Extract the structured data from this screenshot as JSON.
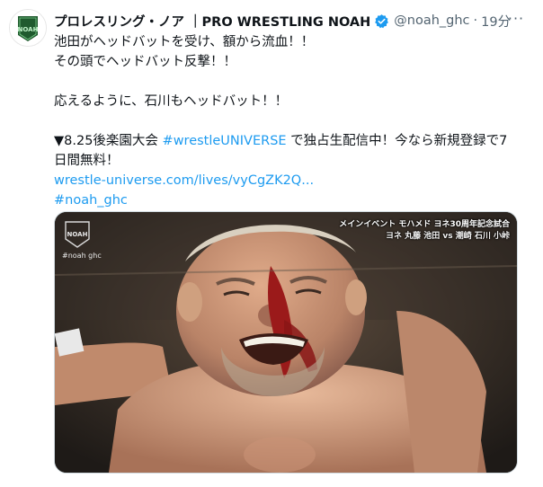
{
  "tweet": {
    "display_name": "プロレスリング・ノア ｜PRO WRESTLING NOAH",
    "handle": "@noah_ghc",
    "separator": "·",
    "time": "19分",
    "more_icon": "more-dots-icon",
    "verified_icon": "verified-badge-icon",
    "lines": [
      "池田がヘッドバットを受け、額から流血！！",
      "その頭でヘッドバット反撃！！",
      "",
      "応えるように、石川もヘッドバット！！",
      ""
    ],
    "line_event_prefix": "▼8.25後楽園大会 ",
    "line_event_hashtag": "#wrestleUNIVERSE",
    "line_event_suffix": " で独占生配信中！今なら新規登録で7",
    "line_event_cont": "日間無料！",
    "url": "wrestle-universe.com/lives/vyCgZK2Q...",
    "hashtag": "#noah_ghc"
  },
  "media": {
    "logo_text": "NOAH",
    "overlay_handle": "#noah ghc",
    "caption_line1": "メインイベント モハメド ヨネ30周年記念試合",
    "caption_line2": "ヨネ 丸藤 池田 vs 潮崎 石川 小峠"
  },
  "colors": {
    "link": "#1d9bf0",
    "muted": "#536471",
    "noah_green": "#1f5a2e",
    "verified": "#1d9bf0"
  }
}
